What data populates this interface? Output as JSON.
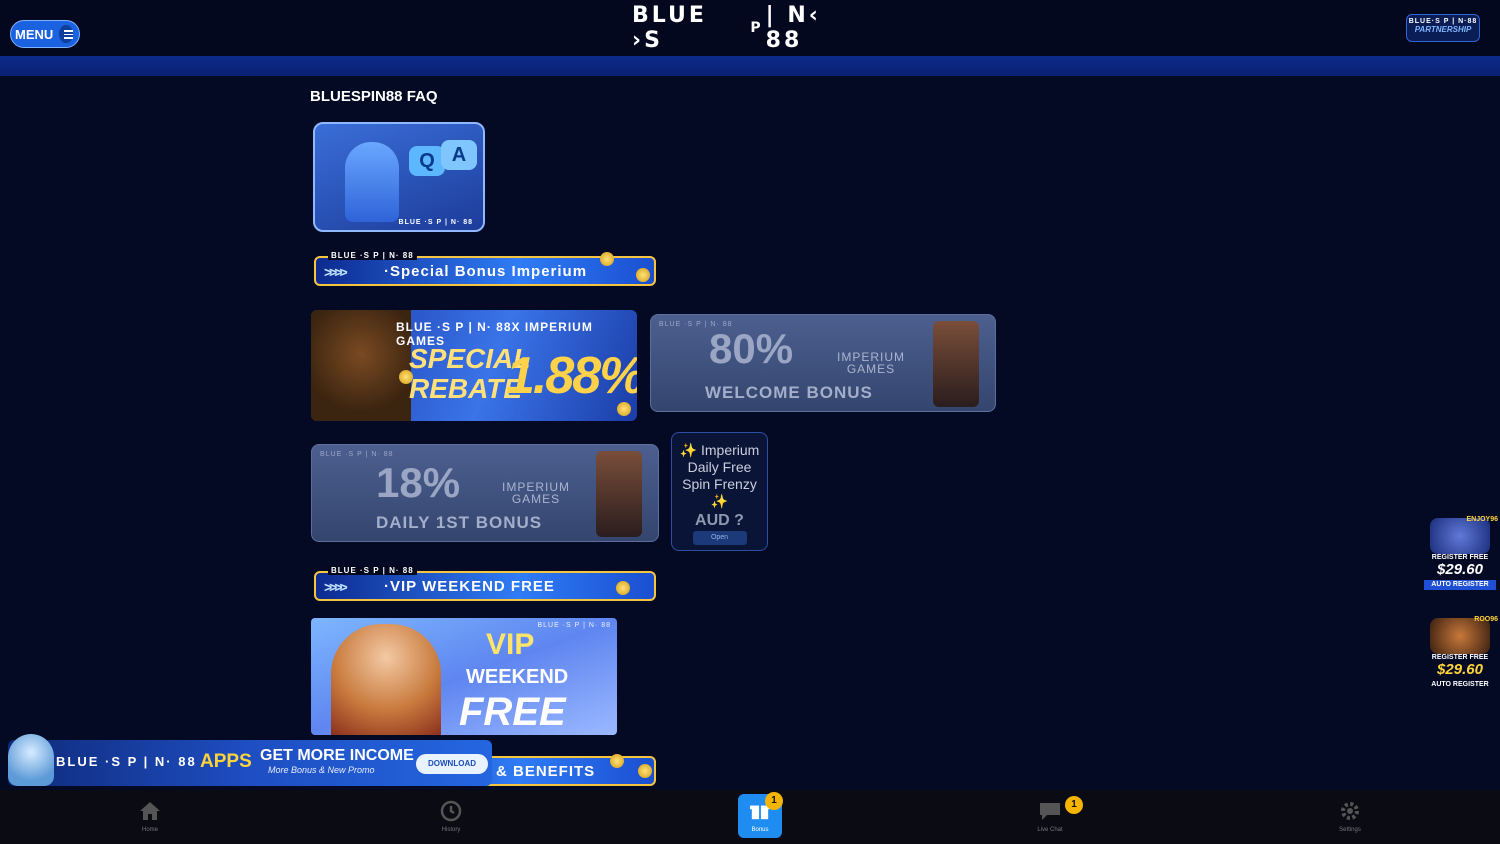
{
  "header": {
    "menu_label": "MENU",
    "logo": {
      "part1": "BLUE ›S",
      "p": "P",
      "part2": "| N‹ 88"
    },
    "partner": {
      "logo": "BLUE·S P | N·88",
      "label": "PARTNERSHIP"
    }
  },
  "page_title": "BLUESPIN88 FAQ",
  "qa_card": {
    "q": "Q",
    "a": "A",
    "logo": "BLUE ·S P | N· 88"
  },
  "banners": {
    "special": {
      "logo": "BLUE ·S P | N· 88",
      "title": "·Special Bonus Imperium"
    },
    "vip": {
      "logo": "BLUE ·S P | N· 88",
      "title": "·VIP WEEKEND FREE"
    },
    "benefits": {
      "title": "& BENEFITS"
    }
  },
  "rebate_card": {
    "logo": "BLUE ·S P | N· 88X IMPERIUM GAMES",
    "line1": "SPECIAL",
    "line2": "REBATE",
    "value": "1.88%"
  },
  "welcome_card": {
    "logo": "BLUE ·S P | N· 88",
    "percent": "80%",
    "brand1": "IMPERIUM",
    "brand2": "GAMES",
    "label": "WELCOME BONUS"
  },
  "daily_card": {
    "logo": "BLUE ·S P | N· 88",
    "percent": "18%",
    "brand1": "IMPERIUM",
    "brand2": "GAMES",
    "label": "DAILY 1ST BONUS"
  },
  "frenzy_card": {
    "title": "✨ Imperium Daily Free Spin Frenzy ✨",
    "amount": "AUD ?",
    "button": "Open"
  },
  "vip_card": {
    "logo": "BLUE ·S P | N· 88",
    "line1": "VIP",
    "line2": "WEEKEND",
    "line3": "FREE"
  },
  "apps_bar": {
    "logo": "BLUE ·S P | N· 88",
    "apps": "APPS",
    "headline": "GET MORE INCOME",
    "sub": "More Bonus & New Promo",
    "download": "DOWNLOAD"
  },
  "side_promos": [
    {
      "brand": "ENJOY96",
      "label": "REGISTER FREE",
      "value": "$29.60",
      "button": "AUTO REGISTER"
    },
    {
      "brand": "ROO96",
      "label": "REGISTER FREE",
      "value": "$29.60",
      "button": "AUTO REGISTER"
    }
  ],
  "bottom_nav": {
    "items": [
      {
        "label": "Home",
        "badge": ""
      },
      {
        "label": "History",
        "badge": ""
      },
      {
        "label": "Bonus",
        "badge": "1"
      },
      {
        "label": "Live Chat",
        "badge": "1"
      },
      {
        "label": "Settings",
        "badge": ""
      }
    ]
  },
  "colors": {
    "background": "#050a24",
    "accent": "#1e8cf0",
    "badge": "#f5b400",
    "gold": "#f5c542"
  }
}
